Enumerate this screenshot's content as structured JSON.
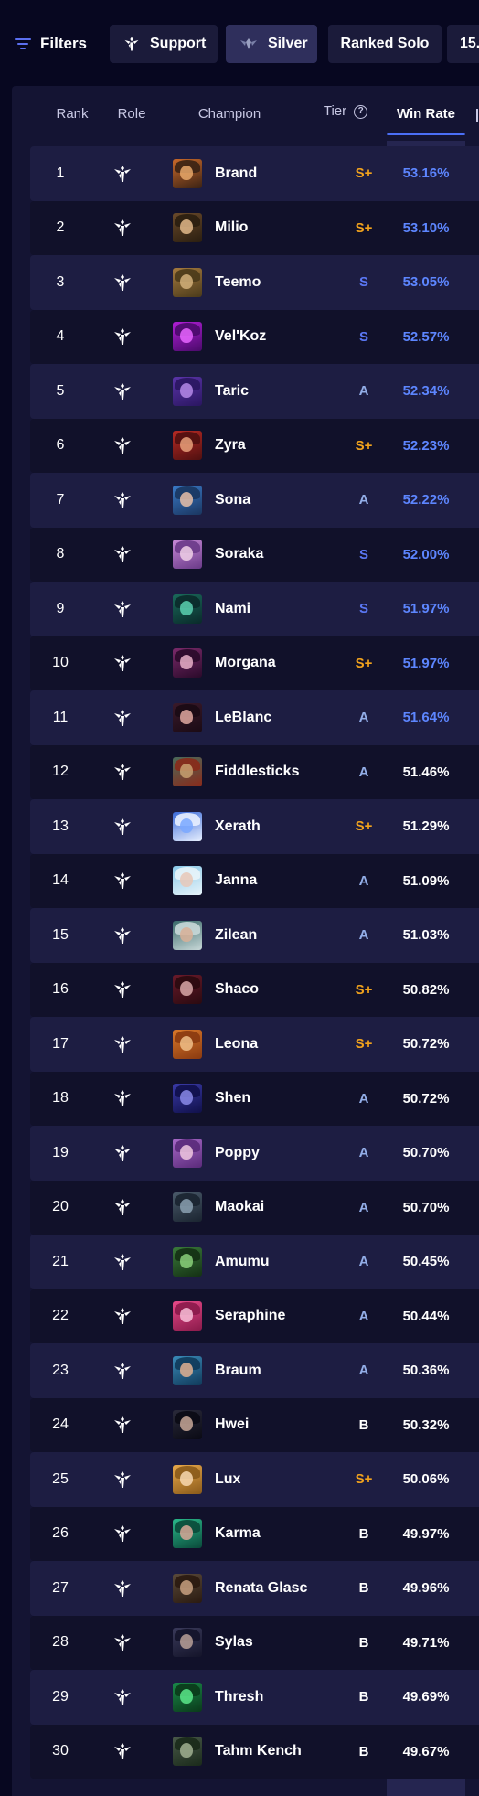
{
  "filters": {
    "label": "Filters",
    "role_chip": "Support",
    "rank_chip": "Silver",
    "queue_chip": "Ranked Solo",
    "patch_chip": "15."
  },
  "table": {
    "headers": {
      "rank": "Rank",
      "role": "Role",
      "champion": "Champion",
      "tier": "Tier",
      "win_rate": "Win Rate"
    },
    "tier_help_icon": "help-circle-icon",
    "role_icon": "support-role-icon",
    "rows": [
      {
        "rank": "1",
        "champion": "Brand",
        "tier": "S+",
        "win_rate": "53.16%",
        "portrait_colors": [
          "#c9692a",
          "#3a2214",
          "#e7a86a"
        ]
      },
      {
        "rank": "2",
        "champion": "Milio",
        "tier": "S+",
        "win_rate": "53.10%",
        "portrait_colors": [
          "#6a4a2a",
          "#2a1e10",
          "#e2b88a"
        ]
      },
      {
        "rank": "3",
        "champion": "Teemo",
        "tier": "S",
        "win_rate": "53.05%",
        "portrait_colors": [
          "#a57a3e",
          "#4a3a1a",
          "#d2b07a"
        ]
      },
      {
        "rank": "4",
        "champion": "Vel'Koz",
        "tier": "S",
        "win_rate": "52.57%",
        "portrait_colors": [
          "#b01ed6",
          "#4a0a6a",
          "#e866ff"
        ]
      },
      {
        "rank": "5",
        "champion": "Taric",
        "tier": "A",
        "win_rate": "52.34%",
        "portrait_colors": [
          "#5a34a8",
          "#2a1660",
          "#b58ae8"
        ]
      },
      {
        "rank": "6",
        "champion": "Zyra",
        "tier": "S+",
        "win_rate": "52.23%",
        "portrait_colors": [
          "#b82a24",
          "#501010",
          "#e8a07a"
        ]
      },
      {
        "rank": "7",
        "champion": "Sona",
        "tier": "A",
        "win_rate": "52.22%",
        "portrait_colors": [
          "#3a7ac8",
          "#1a3660",
          "#e8c0a8"
        ]
      },
      {
        "rank": "8",
        "champion": "Soraka",
        "tier": "S",
        "win_rate": "52.00%",
        "portrait_colors": [
          "#c88ad8",
          "#6a3a88",
          "#f0d0e8"
        ]
      },
      {
        "rank": "9",
        "champion": "Nami",
        "tier": "S",
        "win_rate": "51.97%",
        "portrait_colors": [
          "#1a6a5a",
          "#0a2a2a",
          "#5ad0b0"
        ]
      },
      {
        "rank": "10",
        "champion": "Morgana",
        "tier": "S+",
        "win_rate": "51.97%",
        "portrait_colors": [
          "#7a2a6a",
          "#2a0a2a",
          "#e8b0c8"
        ]
      },
      {
        "rank": "11",
        "champion": "LeBlanc",
        "tier": "A",
        "win_rate": "51.64%",
        "portrait_colors": [
          "#3a1a2a",
          "#1a0a14",
          "#e0a8a0"
        ]
      },
      {
        "rank": "12",
        "champion": "Fiddlesticks",
        "tier": "A",
        "win_rate": "51.46%",
        "portrait_colors": [
          "#4a6a5a",
          "#8a2a1a",
          "#c8a070"
        ]
      },
      {
        "rank": "13",
        "champion": "Xerath",
        "tier": "S+",
        "win_rate": "51.29%",
        "portrait_colors": [
          "#3a6ad8",
          "#e8f0ff",
          "#7aa8ff"
        ]
      },
      {
        "rank": "14",
        "champion": "Janna",
        "tier": "A",
        "win_rate": "51.09%",
        "portrait_colors": [
          "#8ac8e8",
          "#e8f4fa",
          "#e8c8b8"
        ]
      },
      {
        "rank": "15",
        "champion": "Zilean",
        "tier": "A",
        "win_rate": "51.03%",
        "portrait_colors": [
          "#3a6a6a",
          "#c8d8d8",
          "#d8b098"
        ]
      },
      {
        "rank": "16",
        "champion": "Shaco",
        "tier": "S+",
        "win_rate": "50.82%",
        "portrait_colors": [
          "#6a1a2a",
          "#2a0a10",
          "#d8a8a8"
        ]
      },
      {
        "rank": "17",
        "champion": "Leona",
        "tier": "S+",
        "win_rate": "50.72%",
        "portrait_colors": [
          "#d8782a",
          "#8a3a10",
          "#f0c088"
        ]
      },
      {
        "rank": "18",
        "champion": "Shen",
        "tier": "A",
        "win_rate": "50.72%",
        "portrait_colors": [
          "#3a3aa8",
          "#10104a",
          "#8a8ae8"
        ]
      },
      {
        "rank": "19",
        "champion": "Poppy",
        "tier": "A",
        "win_rate": "50.70%",
        "portrait_colors": [
          "#a86ac8",
          "#5a2a7a",
          "#f0c8e0"
        ]
      },
      {
        "rank": "20",
        "champion": "Maokai",
        "tier": "A",
        "win_rate": "50.70%",
        "portrait_colors": [
          "#4a5a6a",
          "#1a2430",
          "#8aa0b0"
        ]
      },
      {
        "rank": "21",
        "champion": "Amumu",
        "tier": "A",
        "win_rate": "50.45%",
        "portrait_colors": [
          "#3a7a3a",
          "#143014",
          "#8ad07a"
        ]
      },
      {
        "rank": "22",
        "champion": "Seraphine",
        "tier": "A",
        "win_rate": "50.44%",
        "portrait_colors": [
          "#e84a8a",
          "#8a1a4a",
          "#f8c0d8"
        ]
      },
      {
        "rank": "23",
        "champion": "Braum",
        "tier": "A",
        "win_rate": "50.36%",
        "portrait_colors": [
          "#3a8ab8",
          "#103a5a",
          "#e0b090"
        ]
      },
      {
        "rank": "24",
        "champion": "Hwei",
        "tier": "B",
        "win_rate": "50.32%",
        "portrait_colors": [
          "#2a2a3a",
          "#0a0a14",
          "#c8a898"
        ]
      },
      {
        "rank": "25",
        "champion": "Lux",
        "tier": "S+",
        "win_rate": "50.06%",
        "portrait_colors": [
          "#e8a84a",
          "#8a5a1a",
          "#f8d8b0"
        ]
      },
      {
        "rank": "26",
        "champion": "Karma",
        "tier": "B",
        "win_rate": "49.97%",
        "portrait_colors": [
          "#2ab88a",
          "#0a4a3a",
          "#d8a898"
        ]
      },
      {
        "rank": "27",
        "champion": "Renata Glasc",
        "tier": "B",
        "win_rate": "49.96%",
        "portrait_colors": [
          "#5a4a3a",
          "#2a1a10",
          "#c8a080"
        ]
      },
      {
        "rank": "28",
        "champion": "Sylas",
        "tier": "B",
        "win_rate": "49.71%",
        "portrait_colors": [
          "#3a3a5a",
          "#14142a",
          "#b8a098"
        ]
      },
      {
        "rank": "29",
        "champion": "Thresh",
        "tier": "B",
        "win_rate": "49.69%",
        "portrait_colors": [
          "#1a8a4a",
          "#0a3a1a",
          "#5ae88a"
        ]
      },
      {
        "rank": "30",
        "champion": "Tahm Kench",
        "tier": "B",
        "win_rate": "49.67%",
        "portrait_colors": [
          "#4a5a4a",
          "#1a2a1a",
          "#a0b090"
        ]
      }
    ]
  },
  "colors": {
    "accent": "#4b6ff6",
    "tier_splus": "#f2a31d",
    "tier_s": "#5b78f5",
    "tier_a": "#93aee8",
    "tier_b": "#ffffff",
    "win_rate_highlight": "#5d86ff"
  }
}
